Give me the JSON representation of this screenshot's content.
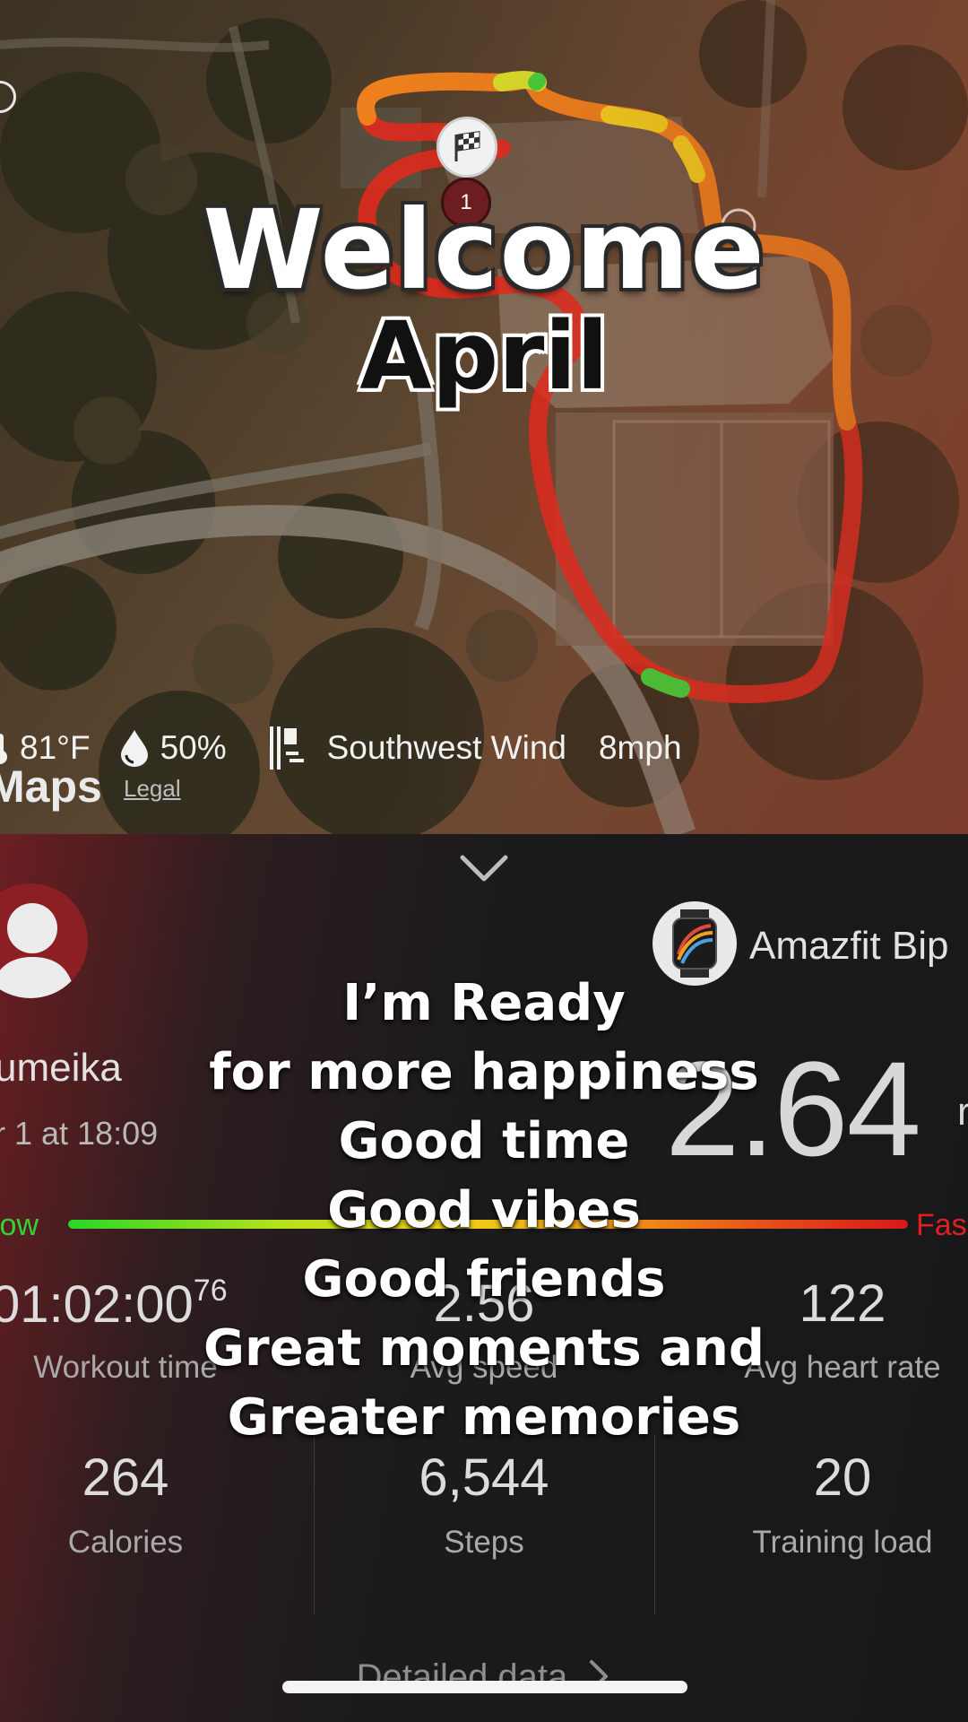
{
  "map": {
    "greeting": "Welcome",
    "month": "April",
    "start_marker_number": "1",
    "brand": "Maps",
    "legal": "Legal",
    "weather": {
      "temperature": "81°F",
      "humidity": "50%",
      "wind_direction": "Southwest Wind",
      "wind_speed": "8mph"
    }
  },
  "workout": {
    "collapse_icon": "chevron-down-icon",
    "username": "umeika",
    "datetime": "r 1 at 18:09",
    "device": "Amazfit Bip",
    "distance": "2.64",
    "distance_unit": "r",
    "pace_scale": {
      "slow": "low",
      "fast": "Fas"
    },
    "stats": {
      "workout_time": {
        "value": "01:02:00",
        "hundredths": "76",
        "label": "Workout time"
      },
      "avg_speed": {
        "value": "2.56",
        "label": "Avg speed"
      },
      "avg_heart_rate": {
        "value": "122",
        "label": "Avg heart rate"
      },
      "calories": {
        "value": "264",
        "label": "Calories"
      },
      "steps": {
        "value": "6,544",
        "label": "Steps"
      },
      "training_load": {
        "value": "20",
        "label": "Training load"
      }
    },
    "detailed_data": "Detailed data"
  },
  "overlay_text": [
    "I’m Ready",
    "for more happiness",
    "Good time",
    "Good vibes",
    "Good friends",
    "Great moments and",
    "Greater memories"
  ],
  "colors": {
    "route_hot": "#e8281c",
    "route_warm": "#f08a1c",
    "pace_slow": "#36d12e",
    "pace_fast": "#e02020",
    "avatar_bg": "#8c1f24"
  }
}
